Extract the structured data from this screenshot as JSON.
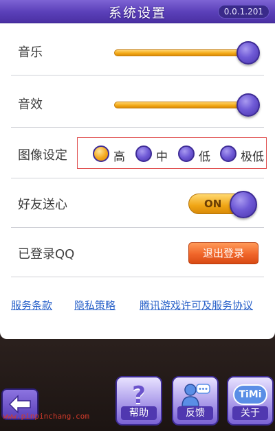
{
  "header": {
    "title": "系统设置",
    "version": "0.0.1.201"
  },
  "settings": {
    "music": {
      "label": "音乐",
      "level": 1.0
    },
    "sound": {
      "label": "音效",
      "level": 1.0
    },
    "quality": {
      "label": "图像设定",
      "options": [
        "高",
        "中",
        "低",
        "极低"
      ],
      "selected": "高"
    },
    "gift": {
      "label": "好友送心",
      "toggle": "ON"
    },
    "account": {
      "label": "已登录QQ",
      "logout_label": "退出登录"
    }
  },
  "links": [
    "服务条款",
    "隐私策略",
    "腾讯游戏许可及服务协议"
  ],
  "bottom": {
    "help_label": "帮助",
    "feedback_label": "反馈",
    "about_label": "关于",
    "about_icon_text": "TiMi",
    "help_icon_text": "?"
  },
  "watermark": "www.pinpinchang.com",
  "colors": {
    "header": "#5a3fb8",
    "accent_orange": "#f0a514",
    "link": "#2a62c9"
  }
}
